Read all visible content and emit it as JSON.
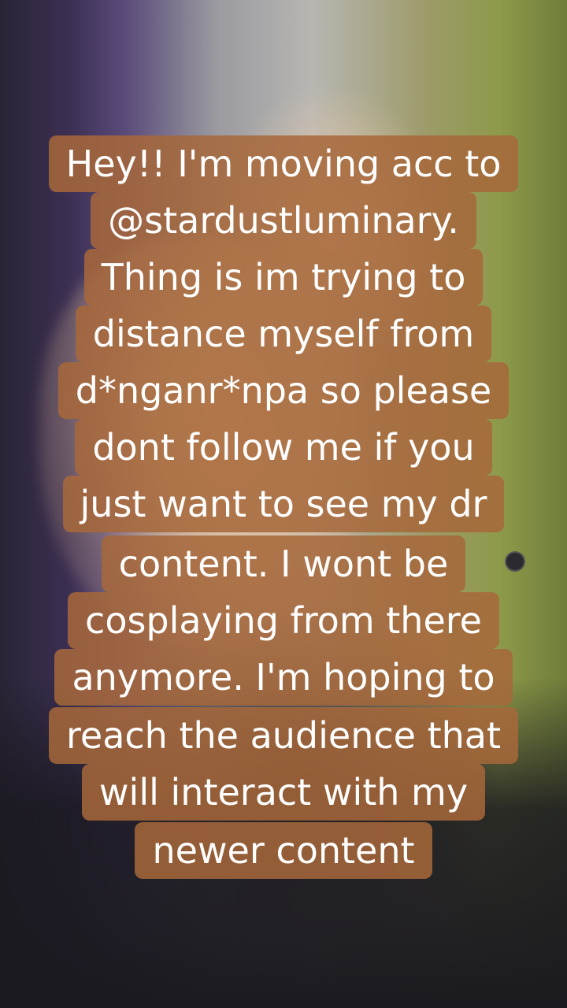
{
  "caption": {
    "lines": [
      "Hey!! I'm moving acc to",
      "@stardustluminary.",
      "Thing is im trying to",
      "distance myself from",
      "d*nganr*npa so please",
      "dont follow me if you",
      "just want to see my dr",
      "content. I wont be",
      "cosplaying from there",
      "anymore. I'm hoping to",
      "reach the audience that",
      "will interact with my",
      "newer content"
    ]
  },
  "colors": {
    "caption_background": "#a6683a",
    "caption_text": "#ffffff"
  }
}
